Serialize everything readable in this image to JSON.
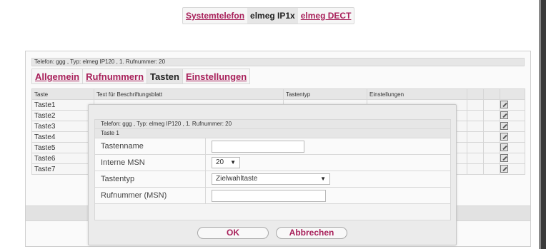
{
  "top_tabs": [
    "Systemtelefon",
    "elmeg IP1x",
    "elmeg DECT"
  ],
  "active_top_tab": "elmeg IP1x",
  "info_line": "Telefon: ggg , Typ: elmeg IP120 , 1. Rufnummer: 20",
  "sub_tabs": [
    "Allgemein",
    "Rufnummern",
    "Tasten",
    "Einstellungen"
  ],
  "active_sub_tab": "Tasten",
  "table": {
    "headers": [
      "Taste",
      "Text für Beschriftungsblatt",
      "Tastentyp",
      "Einstellungen"
    ],
    "rows": [
      "Taste1",
      "Taste2",
      "Taste3",
      "Taste4",
      "Taste5",
      "Taste6",
      "Taste7"
    ],
    "edit_icon": "edit-icon"
  },
  "dialog": {
    "info": "Telefon: ggg , Typ: elmeg IP120 , 1. Rufnummer: 20",
    "key_title": "Taste 1",
    "fields": {
      "tastenname_label": "Tastenname",
      "tastenname_value": "",
      "msn_label": "Interne MSN",
      "msn_value": "20",
      "tastentyp_label": "Tastentyp",
      "tastentyp_value": "Zielwahltaste",
      "rufnummer_label": "Rufnummer (MSN)",
      "rufnummer_value": ""
    },
    "ok_label": "OK",
    "cancel_label": "Abbrechen"
  },
  "colors": {
    "link": "#a8205a",
    "tab_bg": "#f6f6f6",
    "active_tab_bg": "#e6e6e6"
  }
}
